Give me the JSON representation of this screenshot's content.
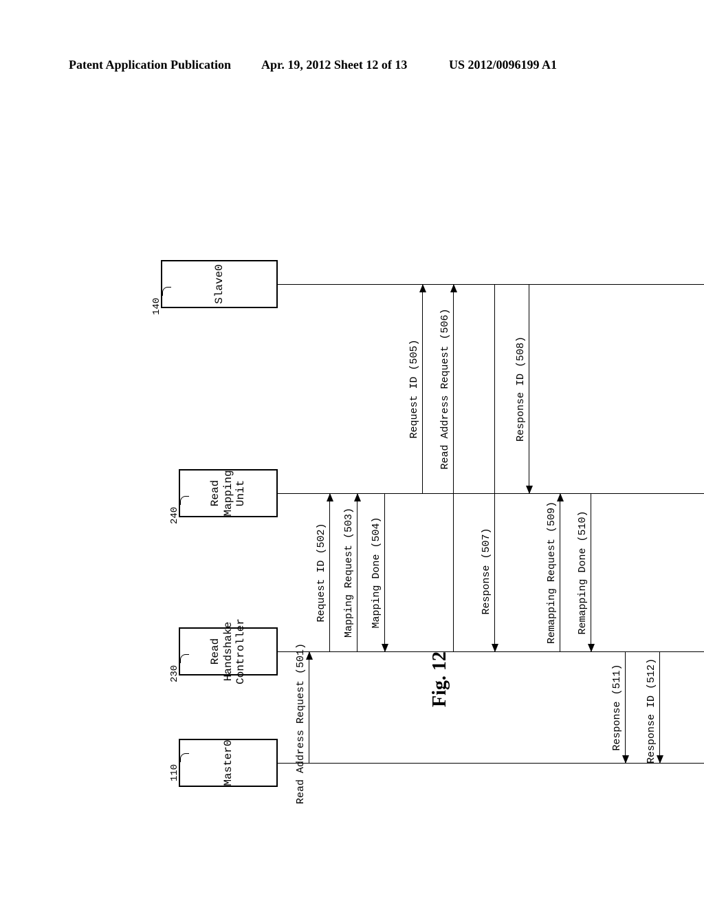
{
  "header": {
    "left": "Patent Application Publication",
    "mid": "Apr. 19, 2012  Sheet 12 of 13",
    "right": "US 2012/0096199 A1"
  },
  "figure_title": "Fig. 12",
  "actors": {
    "master0": {
      "ref": "110",
      "label": "Master0"
    },
    "handshake": {
      "ref": "230",
      "label": "Read Handshake\nController"
    },
    "mapping": {
      "ref": "240",
      "label": "Read Mapping\nUnit"
    },
    "slave0": {
      "ref": "140",
      "label": "Slave0"
    }
  },
  "messages": {
    "m501": "Read Address Request (501)",
    "m502": "Request ID (502)",
    "m503": "Mapping Request (503)",
    "m504": "Mapping Done (504)",
    "m505": "Request ID (505)",
    "m506": "Read Address Request (506)",
    "m507": "Response (507)",
    "m508": "Response ID (508)",
    "m509": "Remapping Request (509)",
    "m510": "Remapping Done (510)",
    "m511": "Response (511)",
    "m512": "Response ID (512)"
  }
}
